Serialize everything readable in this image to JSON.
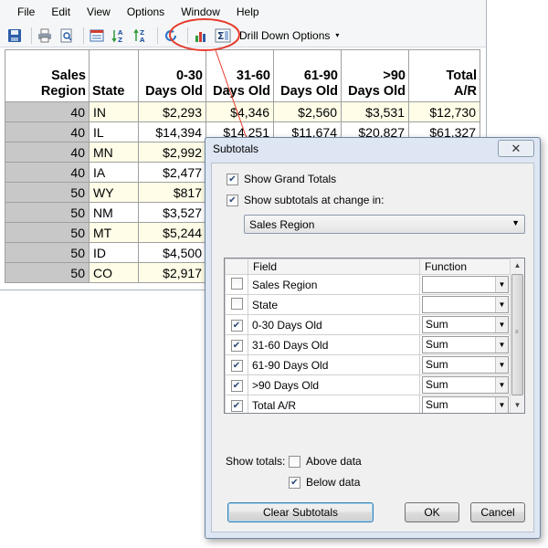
{
  "menu": [
    "File",
    "Edit",
    "View",
    "Options",
    "Window",
    "Help"
  ],
  "toolbar": {
    "icons": [
      "save-icon",
      "print-icon",
      "print-preview-icon",
      "calendar-icon",
      "sort-ascending-icon",
      "sort-descending-icon",
      "refresh-icon",
      "chart-icon",
      "subtotals-icon"
    ],
    "drill_label": "Drill Down Options",
    "drill_caret": "▾"
  },
  "grid": {
    "headers": [
      [
        "Sales",
        "Region"
      ],
      [
        "",
        "State"
      ],
      [
        "0-30",
        "Days Old"
      ],
      [
        "31-60",
        "Days Old"
      ],
      [
        "61-90",
        "Days Old"
      ],
      [
        ">90",
        "Days Old"
      ],
      [
        "Total",
        "A/R"
      ]
    ],
    "rows": [
      {
        "region": "40",
        "state": "IN",
        "d0": "$2,293",
        "d31": "$4,346",
        "d61": "$2,560",
        "d90": "$3,531",
        "total": "$12,730"
      },
      {
        "region": "40",
        "state": "IL",
        "d0": "$14,394",
        "d31": "$14,251",
        "d61": "$11,674",
        "d90": "$20,827",
        "total": "$61,327"
      },
      {
        "region": "40",
        "state": "MN",
        "d0": "$2,992",
        "d31": "",
        "d61": "",
        "d90": "",
        "total": ""
      },
      {
        "region": "40",
        "state": "IA",
        "d0": "$2,477",
        "d31": "",
        "d61": "",
        "d90": "",
        "total": ""
      },
      {
        "region": "50",
        "state": "WY",
        "d0": "$817",
        "d31": "",
        "d61": "",
        "d90": "",
        "total": ""
      },
      {
        "region": "50",
        "state": "NM",
        "d0": "$3,527",
        "d31": "",
        "d61": "",
        "d90": "",
        "total": ""
      },
      {
        "region": "50",
        "state": "MT",
        "d0": "$5,244",
        "d31": "",
        "d61": "",
        "d90": "",
        "total": ""
      },
      {
        "region": "50",
        "state": "ID",
        "d0": "$4,500",
        "d31": "",
        "d61": "",
        "d90": "",
        "total": ""
      },
      {
        "region": "50",
        "state": "CO",
        "d0": "$2,917",
        "d31": "",
        "d61": "",
        "d90": "",
        "total": ""
      }
    ]
  },
  "dialog": {
    "title": "Subtotals",
    "close_glyph": "✕",
    "show_grand_totals": {
      "label": "Show Grand Totals",
      "checked": true
    },
    "show_subtotals": {
      "label": "Show subtotals at change in:",
      "checked": true
    },
    "change_field": "Sales Region",
    "fields_header": {
      "field": "Field",
      "function": "Function"
    },
    "fields": [
      {
        "name": "Sales Region",
        "checked": false,
        "function": ""
      },
      {
        "name": "State",
        "checked": false,
        "function": ""
      },
      {
        "name": "0-30 Days Old",
        "checked": true,
        "function": "Sum"
      },
      {
        "name": "31-60 Days Old",
        "checked": true,
        "function": "Sum"
      },
      {
        "name": "61-90 Days Old",
        "checked": true,
        "function": "Sum"
      },
      {
        "name": ">90 Days Old",
        "checked": true,
        "function": "Sum"
      },
      {
        "name": "Total A/R",
        "checked": true,
        "function": "Sum"
      }
    ],
    "show_totals_label": "Show totals:",
    "above_data": {
      "label": "Above data",
      "checked": false
    },
    "below_data": {
      "label": "Below data",
      "checked": true
    },
    "clear_button": "Clear Subtotals",
    "ok_button": "OK",
    "cancel_button": "Cancel"
  },
  "colors": {
    "highlight_circle": "#e53b2c",
    "row_highlight": "#fffde7",
    "region_cell": "#c8c8c8"
  }
}
